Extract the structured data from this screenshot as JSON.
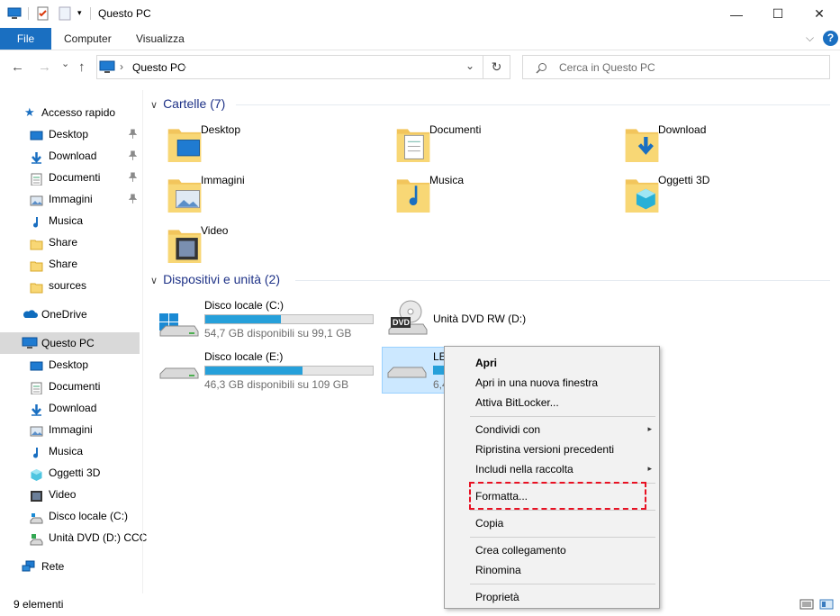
{
  "window": {
    "title": "Questo PC",
    "minimize_glyph": "—",
    "maximize_glyph": "☐",
    "close_glyph": "✕"
  },
  "ribbon": {
    "tabs": [
      "File",
      "Computer",
      "Visualizza"
    ],
    "help_glyph": "?",
    "expand_glyph": "⌵"
  },
  "navigation": {
    "back_glyph": "←",
    "forward_glyph": "→",
    "recent_glyph": "⌄",
    "up_glyph": "↑",
    "address_path": "Questo PC",
    "address_sep": "›",
    "dropdown_glyph": "⌄",
    "refresh_glyph": "↻",
    "search_placeholder": "Cerca in Questo PC"
  },
  "sidebar": {
    "quick_access": "Accesso rapido",
    "quick_items": [
      {
        "label": "Desktop",
        "icon": "desktop-icon",
        "pinned": true
      },
      {
        "label": "Download",
        "icon": "download-icon",
        "pinned": true
      },
      {
        "label": "Documenti",
        "icon": "documents-icon",
        "pinned": true
      },
      {
        "label": "Immagini",
        "icon": "pictures-icon",
        "pinned": true
      },
      {
        "label": "Musica",
        "icon": "music-icon",
        "pinned": false
      },
      {
        "label": "Share",
        "icon": "folder-icon",
        "pinned": false
      },
      {
        "label": "Share",
        "icon": "folder-icon",
        "pinned": false
      },
      {
        "label": "sources",
        "icon": "folder-icon",
        "pinned": false
      }
    ],
    "onedrive": "OneDrive",
    "this_pc": "Questo PC",
    "pc_items": [
      {
        "label": "Desktop",
        "icon": "desktop-icon"
      },
      {
        "label": "Documenti",
        "icon": "documents-icon"
      },
      {
        "label": "Download",
        "icon": "download-icon"
      },
      {
        "label": "Immagini",
        "icon": "pictures-icon"
      },
      {
        "label": "Musica",
        "icon": "music-icon"
      },
      {
        "label": "Oggetti 3D",
        "icon": "3d-objects-icon"
      },
      {
        "label": "Video",
        "icon": "video-icon"
      },
      {
        "label": "Disco locale (C:)",
        "icon": "drive-icon"
      },
      {
        "label": "Unità DVD (D:) CCC",
        "icon": "dvd-drive-icon"
      }
    ],
    "network": "Rete",
    "pin_glyph": "📌"
  },
  "content": {
    "folders_header": "Cartelle (7)",
    "folders": [
      {
        "label": "Desktop",
        "icon": "desktop-folder-icon"
      },
      {
        "label": "Documenti",
        "icon": "documents-folder-icon"
      },
      {
        "label": "Download",
        "icon": "download-folder-icon"
      },
      {
        "label": "Immagini",
        "icon": "pictures-folder-icon"
      },
      {
        "label": "Musica",
        "icon": "music-folder-icon"
      },
      {
        "label": "Oggetti 3D",
        "icon": "3d-objects-folder-icon"
      },
      {
        "label": "Video",
        "icon": "video-folder-icon"
      }
    ],
    "devices_header": "Dispositivi e unità (2)",
    "drives": [
      {
        "name": "Disco locale (C:)",
        "free_text": "54,7 GB disponibili su 99,1 GB",
        "used_fraction": 0.45
      },
      {
        "name": "Unità DVD RW (D:)",
        "dvd_label": "DVD"
      },
      {
        "name": "Disco locale (E:)",
        "free_text": "46,3 GB disponibili su 109 GB",
        "used_fraction": 0.58
      },
      {
        "name": "LE",
        "free_text": "6,4"
      }
    ]
  },
  "context_menu": {
    "items": [
      {
        "label": "Apri",
        "bold": true
      },
      {
        "label": "Apri in una nuova finestra"
      },
      {
        "label": "Attiva BitLocker..."
      },
      {
        "label": "Condividi con",
        "submenu": true
      },
      {
        "label": "Ripristina versioni precedenti"
      },
      {
        "label": "Includi nella raccolta",
        "submenu": true
      },
      {
        "label": "Formatta...",
        "highlighted": true
      },
      {
        "label": "Copia"
      },
      {
        "label": "Crea collegamento"
      },
      {
        "label": "Rinomina"
      },
      {
        "label": "Proprietà"
      }
    ],
    "submenu_glyph": "▸",
    "highlight_color": "#e81123"
  },
  "status": {
    "count": "9 elementi"
  },
  "colors": {
    "accent": "#1a6fc1",
    "folder": "#f2c55c",
    "bar_fill": "#26a0da",
    "section_header": "#1e3287",
    "selection": "#cce8ff"
  }
}
